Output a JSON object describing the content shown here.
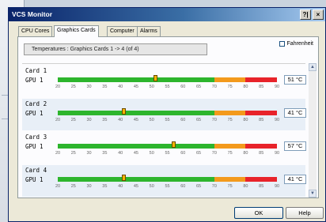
{
  "window": {
    "title": "VCS Monitor",
    "help_glyph": "?|",
    "close_glyph": "×"
  },
  "tabs": [
    {
      "label": "CPU Cores"
    },
    {
      "label": "Graphics Cards"
    },
    {
      "label": "Computer"
    },
    {
      "label": "Alarms"
    }
  ],
  "panel": {
    "fahrenheit_label": "Fahrenheit",
    "fahrenheit_checked": false,
    "header_text": "Temperatures : Graphics Cards 1 -> 4 (of 4)"
  },
  "scale_ticks": [
    "20",
    "25",
    "30",
    "35",
    "40",
    "45",
    "50",
    "55",
    "60",
    "65",
    "70",
    "75",
    "80",
    "85",
    "90"
  ],
  "scale_range": [
    20,
    90
  ],
  "cards": [
    {
      "card_label": "Card  1",
      "gpu_label": "GPU 1",
      "temp_value": 51,
      "temp_text": "51 °C"
    },
    {
      "card_label": "Card  2",
      "gpu_label": "GPU 1",
      "temp_value": 41,
      "temp_text": "41 °C"
    },
    {
      "card_label": "Card  3",
      "gpu_label": "GPU 1",
      "temp_value": 57,
      "temp_text": "57 °C"
    },
    {
      "card_label": "Card  4",
      "gpu_label": "GPU 1",
      "temp_value": 41,
      "temp_text": "41 °C"
    }
  ],
  "scrollbar": {
    "up_glyph": "▲",
    "down_glyph": "▼"
  },
  "buttons": {
    "ok_label": "OK",
    "help_label": "Help"
  },
  "colors": {
    "normal": "#2db52d",
    "warning": "#f39a1c",
    "critical": "#e8232a",
    "marker": "#f4b400"
  }
}
